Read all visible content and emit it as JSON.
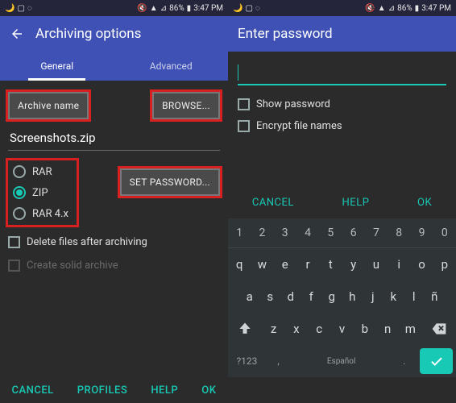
{
  "status": {
    "battery": "86%",
    "time": "3:47 PM"
  },
  "left": {
    "title": "Archiving options",
    "tabs": {
      "general": "General",
      "advanced": "Advanced"
    },
    "archive_name_label": "Archive name",
    "browse": "BROWSE...",
    "filename": "Screenshots.zip",
    "formats": {
      "rar": "RAR",
      "zip": "ZIP",
      "rar4x": "RAR 4.x"
    },
    "set_password": "SET PASSWORD...",
    "delete_after": "Delete files after archiving",
    "solid_archive": "Create solid archive",
    "actions": {
      "cancel": "CANCEL",
      "profiles": "PROFILES",
      "help": "HELP",
      "ok": "OK"
    }
  },
  "right": {
    "title": "Enter password",
    "show_password": "Show password",
    "encrypt_names": "Encrypt file names",
    "actions": {
      "cancel": "CANCEL",
      "help": "HELP",
      "ok": "OK"
    },
    "keyboard": {
      "nums": [
        "1",
        "2",
        "3",
        "4",
        "5",
        "6",
        "7",
        "8",
        "9",
        "0"
      ],
      "row1": [
        "q",
        "w",
        "e",
        "r",
        "t",
        "y",
        "u",
        "i",
        "o",
        "p"
      ],
      "row2": [
        "a",
        "s",
        "d",
        "f",
        "g",
        "h",
        "j",
        "k",
        "l",
        "ñ"
      ],
      "row3": [
        "z",
        "x",
        "c",
        "v",
        "b",
        "n",
        "m"
      ],
      "sym": "?123",
      "lang": "Español"
    }
  }
}
